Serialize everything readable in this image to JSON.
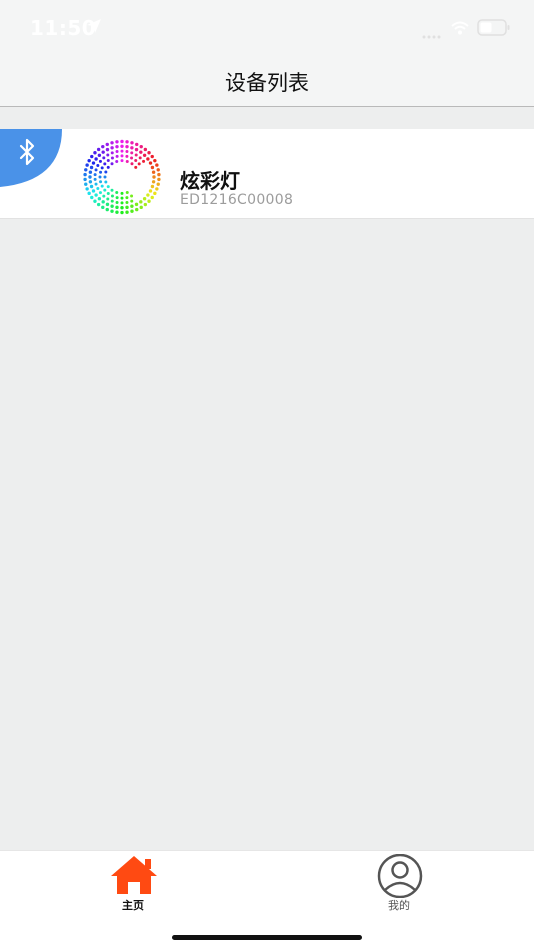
{
  "status_bar": {
    "time": "11:50",
    "icons": [
      "location-arrow-icon",
      "cellular-signal-icon",
      "wifi-icon",
      "battery-icon"
    ]
  },
  "nav": {
    "title": "设备列表"
  },
  "devices": [
    {
      "name": "炫彩灯",
      "id": "ED1216C00008",
      "badge_icon": "bluetooth-icon",
      "logo_icon": "rainbow-ring-icon"
    }
  ],
  "tabs": [
    {
      "label": "主页",
      "icon": "home-icon",
      "active": true,
      "color": "#ff4a12"
    },
    {
      "label": "我的",
      "icon": "user-icon",
      "active": false,
      "color": "#555555"
    }
  ],
  "colors": {
    "background": "#edeeee",
    "bluetooth_badge": "#4a92e8",
    "active_tab": "#ff4a12"
  }
}
